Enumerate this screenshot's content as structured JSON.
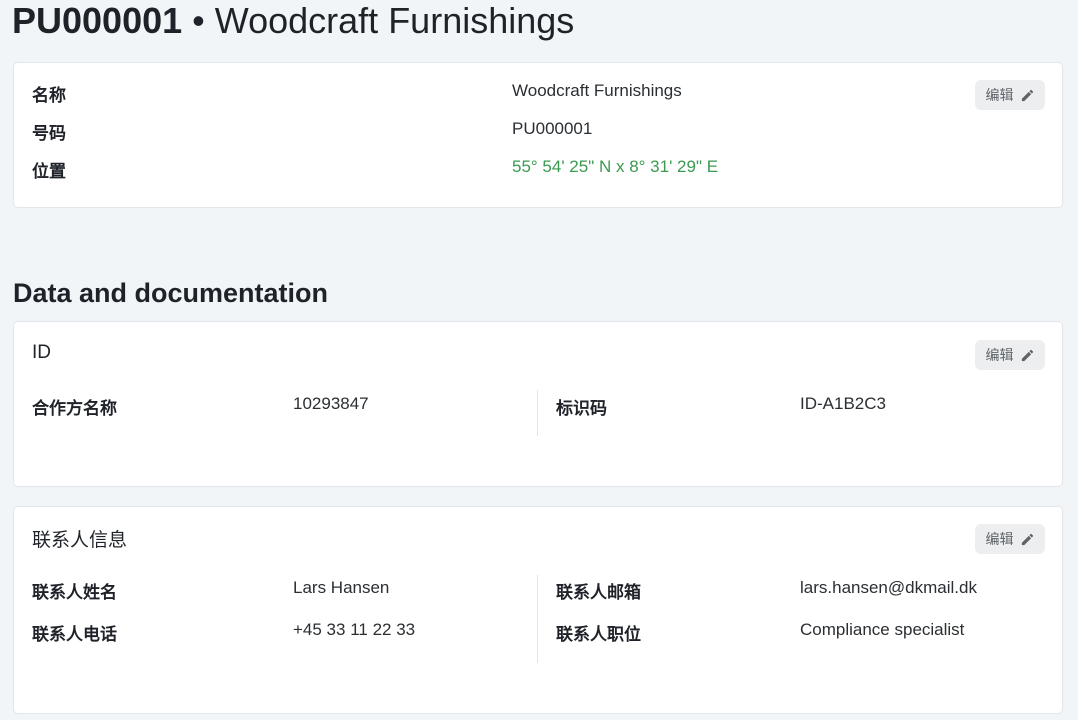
{
  "header": {
    "code": "PU000001",
    "separator": "•",
    "name": "Woodcraft Furnishings"
  },
  "overview": {
    "edit_label": "编辑",
    "rows": [
      {
        "label": "名称",
        "value": "Woodcraft Furnishings"
      },
      {
        "label": "号码",
        "value": "PU000001"
      },
      {
        "label": "位置",
        "value": "55° 54' 25\" N x 8° 31' 29\" E"
      }
    ],
    "location_color": "#3a9a4f"
  },
  "section": {
    "title": "Data and documentation"
  },
  "id_card": {
    "title": "ID",
    "edit_label": "编辑",
    "left": {
      "label": "合作方名称",
      "value": "10293847"
    },
    "right": {
      "label": "标识码",
      "value": "ID-A1B2C3"
    }
  },
  "contact_card": {
    "title": "联系人信息",
    "edit_label": "编辑",
    "left": [
      {
        "label": "联系人姓名",
        "value": "Lars Hansen"
      },
      {
        "label": "联系人电话",
        "value": "+45 33 11 22 33"
      }
    ],
    "right": [
      {
        "label": "联系人邮箱",
        "value": "lars.hansen@dkmail.dk"
      },
      {
        "label": "联系人职位",
        "value": "Compliance specialist"
      }
    ]
  },
  "icons": {
    "edit": "pencil-icon"
  }
}
